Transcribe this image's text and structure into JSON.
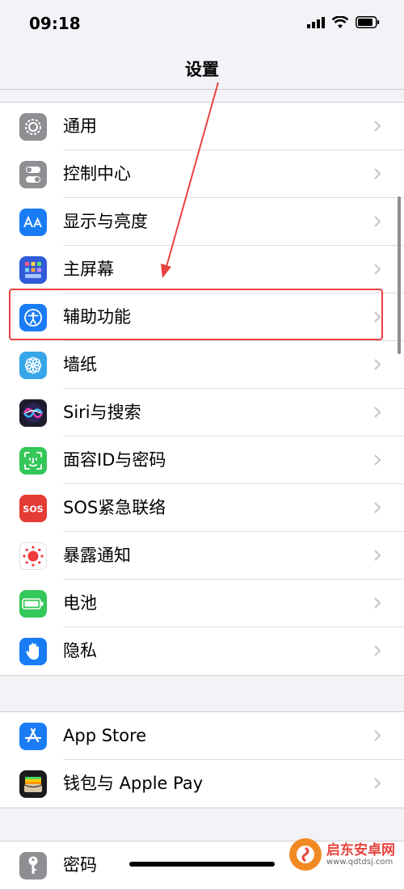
{
  "status": {
    "time": "09:18"
  },
  "nav": {
    "title": "设置"
  },
  "groups": [
    [
      {
        "label": "通用",
        "icon": "gear-icon",
        "color": "#8e8e93"
      },
      {
        "label": "控制中心",
        "icon": "toggles-icon",
        "color": "#8e8e93"
      },
      {
        "label": "显示与亮度",
        "icon": "text-size-icon",
        "color": "#1a7cf5"
      },
      {
        "label": "主屏幕",
        "icon": "home-grid-icon",
        "color": "#2f5bd9"
      },
      {
        "label": "辅助功能",
        "icon": "accessibility-icon",
        "color": "#1a7cf5"
      },
      {
        "label": "墙纸",
        "icon": "flower-icon",
        "color": "#36a6e8"
      },
      {
        "label": "Siri与搜索",
        "icon": "siri-icon",
        "color": "#1c1c2e"
      },
      {
        "label": "面容ID与密码",
        "icon": "face-id-icon",
        "color": "#34c759"
      },
      {
        "label": "SOS紧急联络",
        "icon": "sos-icon",
        "color": "#e53b35"
      },
      {
        "label": "暴露通知",
        "icon": "exposure-icon",
        "color": "#ffffff"
      },
      {
        "label": "电池",
        "icon": "battery-icon",
        "color": "#34c759"
      },
      {
        "label": "隐私",
        "icon": "hand-icon",
        "color": "#1a7cf5"
      }
    ],
    [
      {
        "label": "App Store",
        "icon": "app-store-icon",
        "color": "#1a7cf5"
      },
      {
        "label": "钱包与 Apple Pay",
        "icon": "wallet-icon",
        "color": "#1c1c1e"
      }
    ],
    [
      {
        "label": "密码",
        "icon": "key-icon",
        "color": "#8e8e93"
      }
    ]
  ],
  "watermark": {
    "text": "启东安卓网",
    "url": "www.qdtdsj.com"
  },
  "colors": {
    "highlight": "#e8433f",
    "chevron": "#c4c4c7"
  }
}
